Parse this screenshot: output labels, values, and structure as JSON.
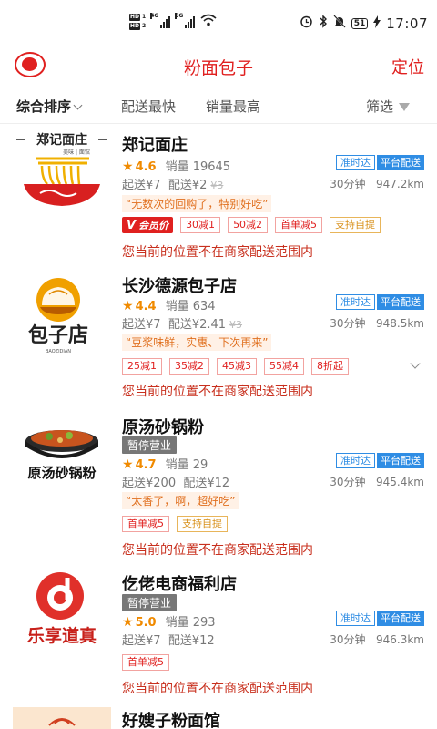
{
  "status_bar": {
    "hd1": "HD",
    "hd1_num": "1",
    "hd2": "HD",
    "hd2_num": "2",
    "sig1": "4G",
    "sig2": "5G",
    "battery": "51",
    "time": "17:07"
  },
  "header": {
    "title": "粉面包子",
    "action": "定位"
  },
  "filters": {
    "sort": "综合排序",
    "fastest": "配送最快",
    "sales": "销量最高",
    "filter": "筛选"
  },
  "colors": {
    "accent": "#e0201f",
    "blue": "#2f8de4",
    "orange": "#f08a00"
  },
  "stores": [
    {
      "name": "郑记面庄",
      "logo_text": "郑记面庄",
      "logo_sub": "美味 | 面馆",
      "paused": "",
      "rating": "4.6",
      "sales": "销量 19645",
      "tag_on_time": "准时达",
      "tag_platform": "平台配送",
      "min_order": "起送¥7",
      "delivery_fee": "配送¥2",
      "original_fee": "¥3",
      "time": "30分钟",
      "distance": "947.2km",
      "review": "“无数次的回购了，特别好吃”",
      "vip_label": "会员价",
      "promos": [
        "30减1",
        "50减2",
        "首单减5",
        "支持自提"
      ],
      "notice": "您当前的位置不在商家配送范围内"
    },
    {
      "name": "长沙德源包子店",
      "logo_text": "包子店",
      "logo_sub": "BAOZIDIAN",
      "paused": "",
      "rating": "4.4",
      "sales": "销量 634",
      "tag_on_time": "准时达",
      "tag_platform": "平台配送",
      "min_order": "起送¥7",
      "delivery_fee": "配送¥2.41",
      "original_fee": "¥3",
      "time": "30分钟",
      "distance": "948.5km",
      "review": "“豆浆味鲜，实惠、下次再来”",
      "promos": [
        "25减1",
        "35减2",
        "45减3",
        "55减4",
        "8折起"
      ],
      "notice": "您当前的位置不在商家配送范围内"
    },
    {
      "name": "原汤砂锅粉",
      "logo_text": "原汤砂锅粉",
      "paused": "暂停营业",
      "rating": "4.7",
      "sales": "销量 29",
      "tag_on_time": "准时达",
      "tag_platform": "平台配送",
      "min_order": "起送¥200",
      "delivery_fee": "配送¥12",
      "time": "30分钟",
      "distance": "945.4km",
      "review": "“太香了，啊，超好吃”",
      "promos": [
        "首单减5",
        "支持自提"
      ],
      "notice": "您当前的位置不在商家配送范围内"
    },
    {
      "name": "仡佬电商福利店",
      "logo_text": "乐享道真",
      "paused": "暂停营业",
      "rating": "5.0",
      "sales": "销量 293",
      "tag_on_time": "准时达",
      "tag_platform": "平台配送",
      "min_order": "起送¥7",
      "delivery_fee": "配送¥12",
      "time": "30分钟",
      "distance": "946.3km",
      "promos": [
        "首单减5"
      ],
      "notice": "您当前的位置不在商家配送范围内"
    },
    {
      "name": "好嫂子粉面馆"
    }
  ]
}
